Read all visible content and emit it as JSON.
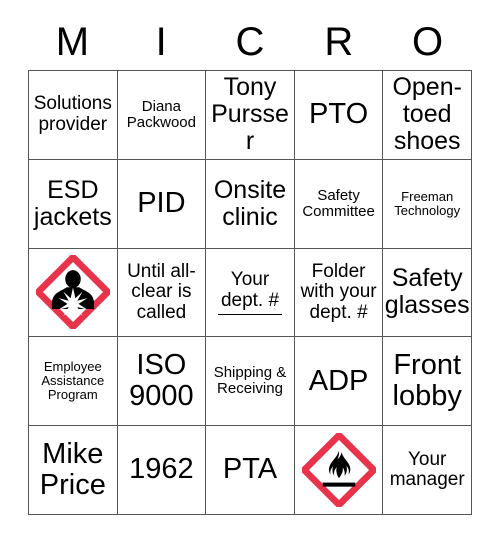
{
  "header": {
    "letters": [
      "M",
      "I",
      "C",
      "R",
      "O"
    ]
  },
  "colors": {
    "ghs_red": "#E8334A",
    "grid_line": "#555555",
    "text": "#000000",
    "background": "#FFFFFF"
  },
  "grid": {
    "rows": 5,
    "columns": 5,
    "cells": [
      {
        "text": "Solutions provider",
        "type": "text",
        "size": "md"
      },
      {
        "text": "Diana Packwood",
        "type": "text",
        "size": "sm"
      },
      {
        "text": "Tony Pursser",
        "type": "text",
        "size": "lg"
      },
      {
        "text": "PTO",
        "type": "text",
        "size": "xl"
      },
      {
        "text": "Open-toed shoes",
        "type": "text",
        "size": "lg"
      },
      {
        "text": "ESD jackets",
        "type": "text",
        "size": "lg"
      },
      {
        "text": "PID",
        "type": "text",
        "size": "xl"
      },
      {
        "text": "Onsite clinic",
        "type": "text",
        "size": "lg"
      },
      {
        "text": "Safety Committee",
        "type": "text",
        "size": "sm"
      },
      {
        "text": "Freeman Technology",
        "type": "text",
        "size": "xs"
      },
      {
        "text": "",
        "type": "icon",
        "icon": "ghs-health-hazard-icon"
      },
      {
        "text": "Until all-clear is called",
        "type": "text",
        "size": "md"
      },
      {
        "text": "Your dept. #",
        "type": "text",
        "size": "md",
        "blank_line": true
      },
      {
        "text": "Folder with your dept. #",
        "type": "text",
        "size": "md"
      },
      {
        "text": "Safety glasses",
        "type": "text",
        "size": "lg"
      },
      {
        "text": "Employee Assistance Program",
        "type": "text",
        "size": "xs"
      },
      {
        "text": "ISO 9000",
        "type": "text",
        "size": "xl"
      },
      {
        "text": "Shipping & Receiving",
        "type": "text",
        "size": "sm"
      },
      {
        "text": "ADP",
        "type": "text",
        "size": "xl"
      },
      {
        "text": "Front lobby",
        "type": "text",
        "size": "xl"
      },
      {
        "text": "Mike Price",
        "type": "text",
        "size": "xl"
      },
      {
        "text": "1962",
        "type": "text",
        "size": "xl"
      },
      {
        "text": "PTA",
        "type": "text",
        "size": "xl"
      },
      {
        "text": "",
        "type": "icon",
        "icon": "ghs-flammable-icon"
      },
      {
        "text": "Your manager",
        "type": "text",
        "size": "md"
      }
    ]
  }
}
